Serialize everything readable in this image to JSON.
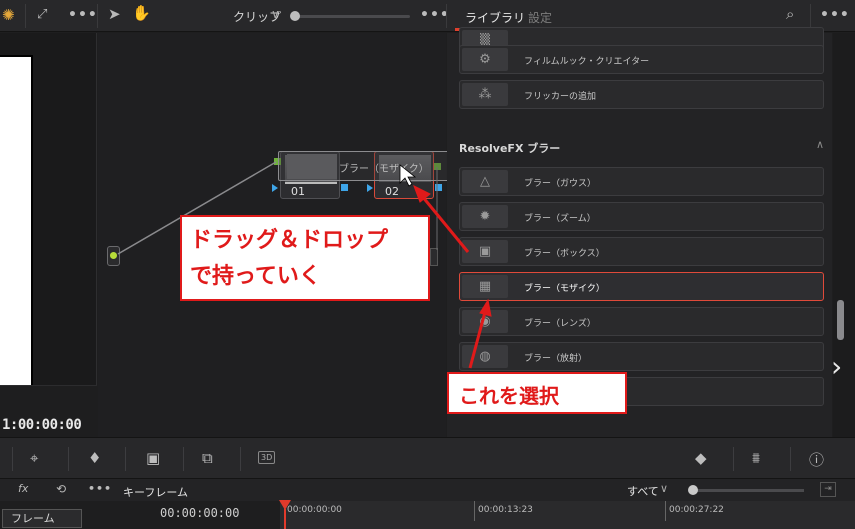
{
  "topbar": {
    "clip_label": "クリップ",
    "tab_library": "ライブラリ",
    "tab_settings": "設定"
  },
  "viewer": {
    "timecode": "1:00:00:00"
  },
  "nodes": {
    "node1_label": "01",
    "node2_label": "02",
    "drag_ghost_label": "ブラー（モザイク）"
  },
  "library": {
    "items_top": [
      {
        "label": ""
      },
      {
        "label": "フィルムルック・クリエイター"
      },
      {
        "label": "フリッカーの追加"
      }
    ],
    "section_title": "ResolveFX ブラー",
    "items": [
      {
        "label": "ブラー（ガウス）"
      },
      {
        "label": "ブラー（ズーム）"
      },
      {
        "label": "ブラー（ボックス）"
      },
      {
        "label": "ブラー（モザイク）"
      },
      {
        "label": "ブラー（レンズ）"
      },
      {
        "label": "ブラー（放射）"
      }
    ]
  },
  "keyframes": {
    "label": "キーフレーム",
    "filter": "すべて",
    "frame_button": "フレーム",
    "current_time": "00:00:00:00",
    "ticks": [
      "00:00:00:00",
      "00:00:13:23",
      "00:00:27:22"
    ]
  },
  "annotations": {
    "callout1_line1": "ドラッグ＆ドロップ",
    "callout1_line2": "で持っていく",
    "callout2": "これを選択"
  },
  "colors": {
    "accent": "#e0402d",
    "annotation_red": "#e01a1a",
    "port_blue": "#3ea5e8"
  }
}
